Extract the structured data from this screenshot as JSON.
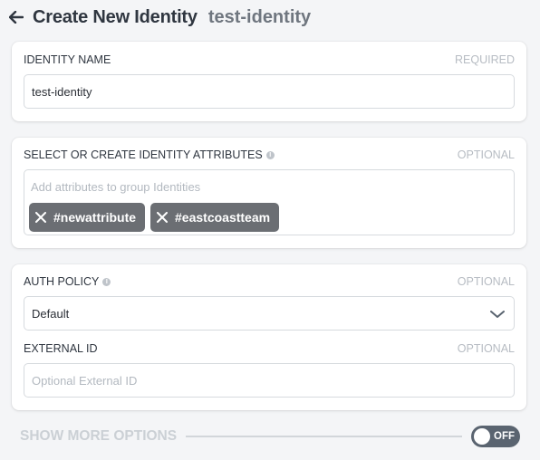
{
  "header": {
    "title": "Create New Identity",
    "identity_name": "test-identity"
  },
  "identity_name": {
    "label": "IDENTITY NAME",
    "hint": "REQUIRED",
    "value": "test-identity"
  },
  "attributes": {
    "label": "SELECT OR CREATE IDENTITY ATTRIBUTES",
    "hint": "OPTIONAL",
    "placeholder": "Add attributes to group Identities",
    "tags": [
      "#newattribute",
      "#eastcoastteam"
    ]
  },
  "auth_policy": {
    "label": "AUTH POLICY",
    "hint": "OPTIONAL",
    "selected": "Default"
  },
  "external_id": {
    "label": "EXTERNAL ID",
    "hint": "OPTIONAL",
    "placeholder": "Optional External ID"
  },
  "footer": {
    "show_more_label": "SHOW MORE OPTIONS",
    "toggle_state": "OFF"
  },
  "colors": {
    "tag_bg": "#6b6e73",
    "toggle_bg": "#5a6470",
    "page_bg": "#f4f5f7"
  }
}
